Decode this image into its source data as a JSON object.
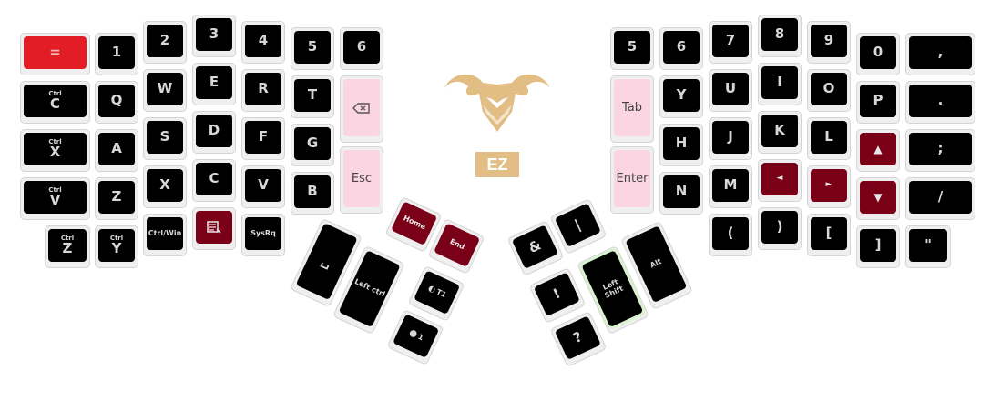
{
  "logo": {
    "badge_text": "EZ",
    "icon": "ram-head-icon",
    "color": "#e2be84"
  },
  "colors": {
    "red": "#e31d26",
    "maroon": "#7a0018",
    "pink": "#fbd5e2",
    "black": "#000000"
  },
  "left_hand": {
    "row0": [
      "=",
      "1",
      "2",
      "3",
      "4",
      "5",
      "6"
    ],
    "row1": [
      {
        "mod": "Ctrl",
        "main": "C"
      },
      "Q",
      "W",
      "E",
      "R",
      "T",
      "backspace-icon"
    ],
    "row2": [
      {
        "mod": "Ctrl",
        "main": "X"
      },
      "A",
      "S",
      "D",
      "F",
      "G",
      "Esc"
    ],
    "row3": [
      {
        "mod": "Ctrl",
        "main": "V"
      },
      "Z",
      "X",
      "C",
      "V",
      "B"
    ],
    "row4": [
      {
        "mod": "Ctrl",
        "main": "Z"
      },
      {
        "mod": "Ctrl",
        "main": "Y"
      },
      "Ctrl/Win",
      "menu-icon",
      "SysRq"
    ]
  },
  "right_hand": {
    "row0": [
      "5",
      "6",
      "7",
      "8",
      "9",
      "0",
      ","
    ],
    "row1": [
      "Tab",
      "Y",
      "U",
      "I",
      "O",
      "P",
      "."
    ],
    "row2": [
      "Enter",
      "H",
      "J",
      "K",
      "L",
      "▲",
      ";"
    ],
    "row3": [
      "N",
      "M",
      "◄",
      "►",
      "▼",
      "/"
    ],
    "row4": [
      "(",
      ")",
      "[",
      "]",
      "\""
    ]
  },
  "left_thumb": {
    "space": "␣",
    "left_ctrl": "Left ctrl",
    "home": "Home",
    "end": "End",
    "t1": "T1",
    "t1_icon": "layer-toggle-icon",
    "m1": "1",
    "m1_icon": "layer-momentary-icon"
  },
  "right_thumb": {
    "amp": "&",
    "pipe": "|",
    "bang": "!",
    "question": "?",
    "left_shift": "Left Shift",
    "alt": "Alt"
  }
}
